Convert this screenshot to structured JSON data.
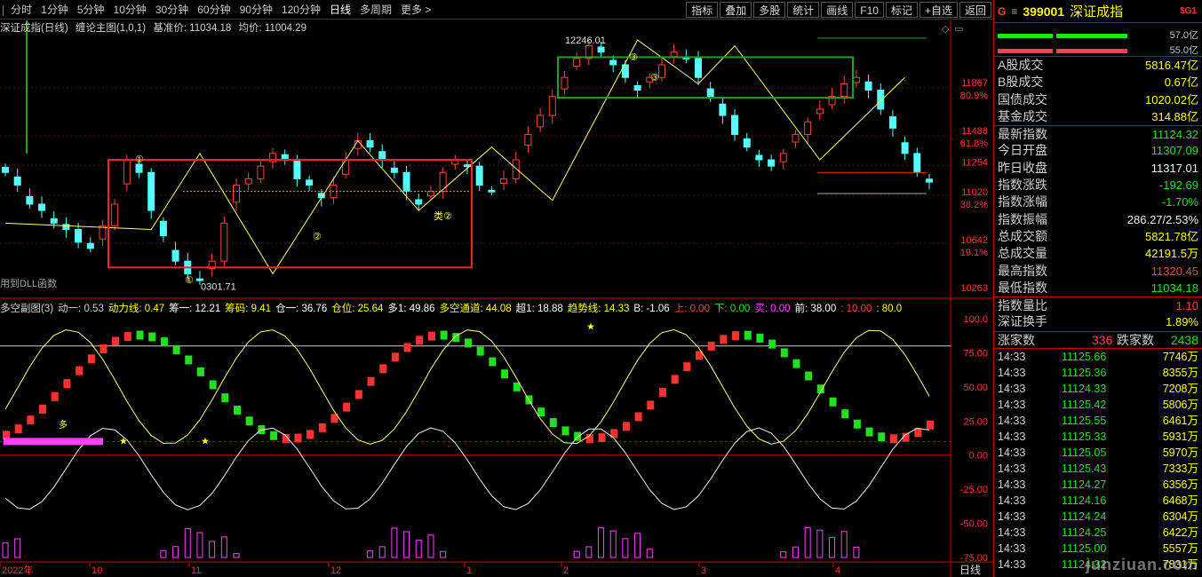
{
  "toolbar": {
    "periods": [
      "分时",
      "1分钟",
      "5分钟",
      "10分钟",
      "30分钟",
      "60分钟",
      "90分钟",
      "120分钟",
      "日线",
      "多周期",
      "更多 >"
    ],
    "active": "日线",
    "buttons": [
      "指标",
      "叠加",
      "多股",
      "统计",
      "画线",
      "F10",
      "标记",
      "+自选",
      "返回"
    ]
  },
  "main": {
    "info": {
      "name": "深证成指(日线)",
      "indicator": "缠论主图(1,0,1)",
      "base_label": "基准价: 11034.18",
      "avg_label": "均价: 11004.29"
    },
    "price_labels": [
      "11867",
      "80.9%",
      "11488",
      "61.8%",
      "11254",
      "11020",
      "38.2%",
      "10642",
      "19.1%",
      "10263"
    ],
    "annotations": {
      "high": "12246.01",
      "low": "0301.71",
      "class2": "类②",
      "dll": "用到DLL函数",
      "c2": "②",
      "c1": "①",
      "c3": "③"
    },
    "sub_info": [
      "多空副图(3)",
      "动一: 0.53",
      "动力线: 0.47",
      "筹一: 12.21",
      "筹码: 9.41",
      "仓一: 36.76",
      "仓位: 25.64",
      "多1: 49.86",
      "多空通道: 44.08",
      "超1: 18.88",
      "趋势线: 14.33",
      "B: -1.06",
      "上: 0.00",
      "下: 0.00",
      "买: 0.00",
      "前: 38.00",
      ": 10.00",
      ": 80.0"
    ],
    "sub_axis": [
      "100.0",
      "75.00",
      "50.00",
      "25.00",
      "0.00",
      "-25.00",
      "-50.00",
      "-75.00"
    ],
    "sub_note": "多",
    "date_labels": [
      "2022年",
      "10",
      "11",
      "12",
      "1",
      "2",
      "3",
      "4"
    ],
    "period_tag": "日线"
  },
  "side": {
    "code": "399001",
    "name": "深证成指",
    "prefix": "G",
    "menu": "≡",
    "badge": "$G1",
    "bar_vals": [
      "57.0亿",
      "55.0亿"
    ],
    "stats": [
      {
        "label": "A股成交",
        "value": "5816.47亿",
        "color": "yl"
      },
      {
        "label": "B股成交",
        "value": "0.67亿",
        "color": "yl"
      },
      {
        "label": "国债成交",
        "value": "1020.02亿",
        "color": "yl"
      },
      {
        "label": "基金成交",
        "value": "314.88亿",
        "color": "yl"
      },
      {
        "label": "最新指数",
        "value": "11124.32",
        "color": "dn"
      },
      {
        "label": "今日开盘",
        "value": "11307.09",
        "color": "dn"
      },
      {
        "label": "昨日收盘",
        "value": "11317.01",
        "color": "wh"
      },
      {
        "label": "指数涨跌",
        "value": "-192.69",
        "color": "dn"
      },
      {
        "label": "指数涨幅",
        "value": "-1.70%",
        "color": "dn"
      },
      {
        "label": "指数振幅",
        "value": "286.27/2.53%",
        "color": "wh"
      },
      {
        "label": "总成交额",
        "value": "5821.78亿",
        "color": "yl"
      },
      {
        "label": "总成交量",
        "value": "42191.5万",
        "color": "yl"
      },
      {
        "label": "最高指数",
        "value": "11320.45",
        "color": "up"
      },
      {
        "label": "最低指数",
        "value": "11034.18",
        "color": "dn"
      },
      {
        "label": "指数量比",
        "value": "1.10",
        "color": "up"
      },
      {
        "label": "深证换手",
        "value": "1.89%",
        "color": "yl"
      }
    ],
    "updown": {
      "up_label": "涨家数",
      "up": "336",
      "down_label": "跌家数",
      "down": "2438"
    },
    "ticks": [
      {
        "t": "14:33",
        "p": "11125.66",
        "v": "7746万"
      },
      {
        "t": "14:33",
        "p": "11125.36",
        "v": "8355万"
      },
      {
        "t": "14:33",
        "p": "11124.33",
        "v": "7208万"
      },
      {
        "t": "14:33",
        "p": "11125.42",
        "v": "5806万"
      },
      {
        "t": "14:33",
        "p": "11125.55",
        "v": "6461万"
      },
      {
        "t": "14:33",
        "p": "11125.33",
        "v": "5931万"
      },
      {
        "t": "14:33",
        "p": "11125.05",
        "v": "5970万"
      },
      {
        "t": "14:33",
        "p": "11125.43",
        "v": "7333万"
      },
      {
        "t": "14:33",
        "p": "11124.27",
        "v": "6356万"
      },
      {
        "t": "14:33",
        "p": "11124.16",
        "v": "6468万"
      },
      {
        "t": "14:33",
        "p": "11124.24",
        "v": "6304万"
      },
      {
        "t": "14:33",
        "p": "11124.25",
        "v": "6422万"
      },
      {
        "t": "14:33",
        "p": "11125.00",
        "v": "5557万"
      },
      {
        "t": "14:33",
        "p": "11124.32",
        "v": "7831万"
      }
    ],
    "watermark": "junziuan.com"
  },
  "chart_data": {
    "type": "candlestick",
    "y_axis_ticks": [
      11867,
      11488,
      11254,
      11020,
      10642,
      10263
    ],
    "fib_levels": [
      "80.9%",
      "61.8%",
      "38.2%",
      "19.1%"
    ],
    "high_annotation": 12246.01,
    "base_price": 11034.18,
    "avg_price": 11004.29,
    "closes": [
      11200,
      11100,
      10950,
      10900,
      10800,
      10750,
      10650,
      10600,
      10780,
      10950,
      11300,
      11200,
      10900,
      10700,
      10500,
      10400,
      10350,
      10500,
      10800,
      11100,
      11150,
      11250,
      11350,
      11300,
      11150,
      11100,
      11000,
      11100,
      11300,
      11450,
      11400,
      11300,
      11200,
      11050,
      10950,
      11050,
      11200,
      11300,
      11250,
      11100,
      11050,
      11150,
      11300,
      11500,
      11650,
      11800,
      11950,
      12100,
      12200,
      12150,
      12050,
      11950,
      11850,
      11950,
      12050,
      12150,
      12100,
      11950,
      11800,
      11650,
      11500,
      11400,
      11300,
      11250,
      11350,
      11500,
      11600,
      11700,
      11800,
      11900,
      11950,
      11850,
      11700,
      11550,
      11350,
      11200,
      11124
    ],
    "sub_indicator": {
      "values_labels": [
        "动一",
        "动力线",
        "筹一",
        "筹码",
        "仓一",
        "仓位",
        "多1",
        "多空通道",
        "超1",
        "趋势线",
        "B"
      ],
      "values": [
        0.53,
        0.47,
        12.21,
        9.41,
        36.76,
        25.64,
        49.86,
        44.08,
        18.88,
        14.33,
        -1.06
      ],
      "y_range": [
        -75,
        100
      ]
    }
  }
}
